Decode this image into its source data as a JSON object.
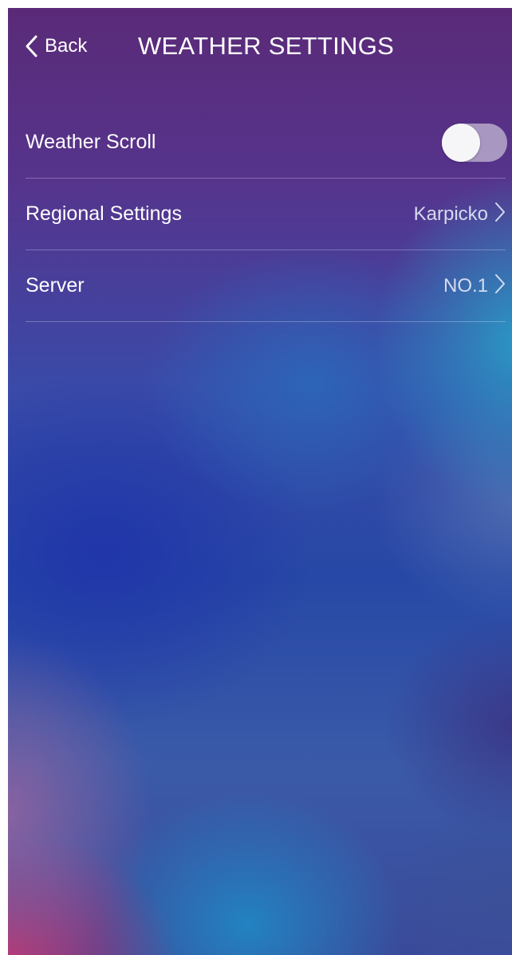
{
  "header": {
    "back_label": "Back",
    "title": "WEATHER SETTINGS"
  },
  "settings": {
    "weather_scroll": {
      "label": "Weather Scroll",
      "enabled": false
    },
    "regional_settings": {
      "label": "Regional Settings",
      "value": "Karpicko"
    },
    "server": {
      "label": "Server",
      "value": "NO.1"
    }
  },
  "icons": {
    "back": "chevron-left-icon",
    "row_arrow": "chevron-right-icon"
  },
  "colors": {
    "text": "#ffffff",
    "divider": "rgba(255,255,255,0.28)",
    "toggle_track_off": "rgba(235,235,240,0.55)",
    "toggle_knob": "#f6f6f8"
  }
}
